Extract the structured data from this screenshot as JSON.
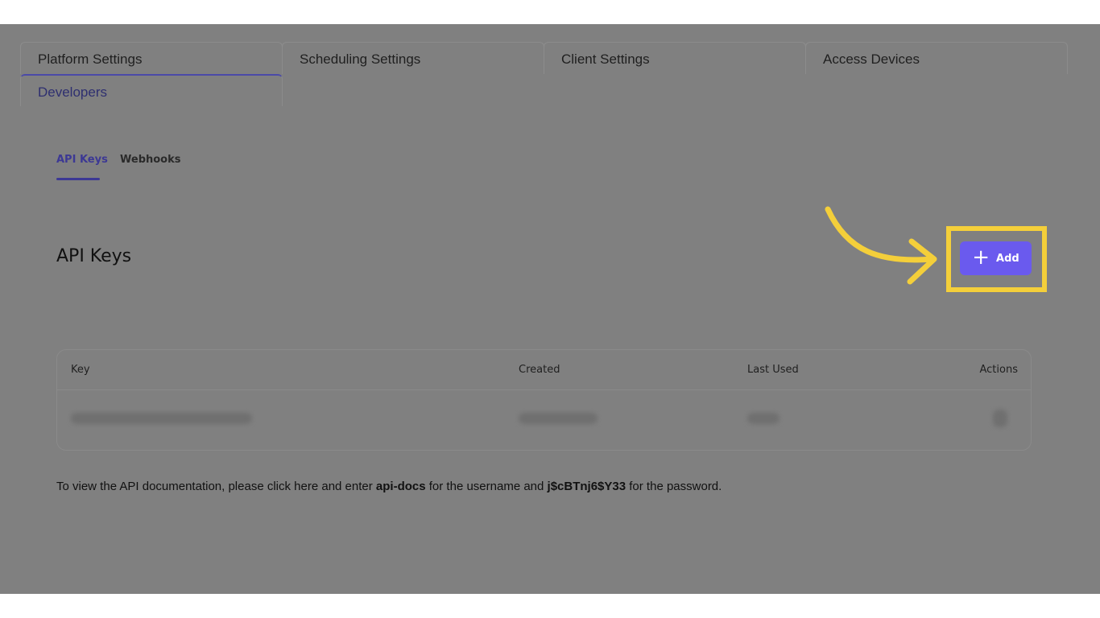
{
  "tabs": [
    {
      "label": "Platform Settings"
    },
    {
      "label": "Scheduling Settings"
    },
    {
      "label": "Client Settings"
    },
    {
      "label": "Access Devices"
    },
    {
      "label": "Developers"
    }
  ],
  "subtabs": [
    {
      "label": "API Keys"
    },
    {
      "label": "Webhooks"
    }
  ],
  "page_title": "API Keys",
  "add_button": {
    "label": "Add",
    "icon": "plus-icon"
  },
  "table": {
    "headers": [
      "Key",
      "Created",
      "Last Used",
      "Actions"
    ]
  },
  "note": {
    "prefix": "To view the API documentation, please click here and enter ",
    "username": "api-docs",
    "middle": " for the username and ",
    "password": "j$cBTnj6$Y33",
    "suffix": " for the password."
  },
  "colors": {
    "accent": "#6a5aee",
    "highlight": "#f4cf3a",
    "overlay": "#808080"
  }
}
